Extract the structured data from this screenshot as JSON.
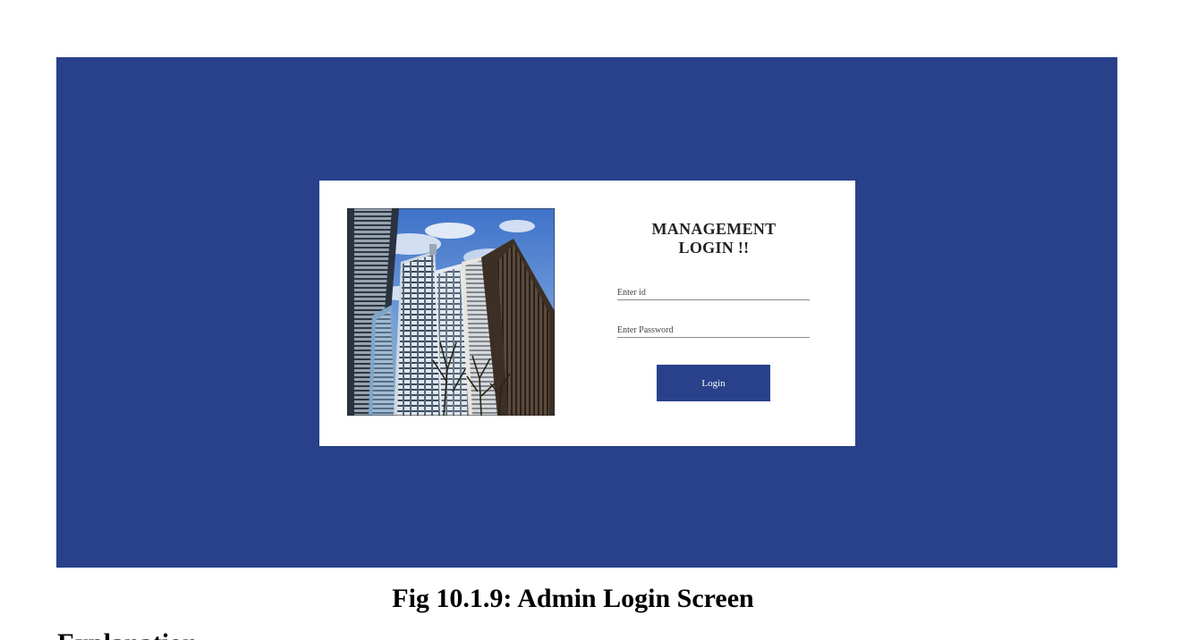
{
  "login": {
    "title": "MANAGEMENT LOGIN !!",
    "id_placeholder": "Enter id",
    "password_placeholder": "Enter Password",
    "button_label": "Login"
  },
  "caption": "Fig 10.1.9: Admin Login Screen",
  "next_heading_fragment": "Explanation",
  "colors": {
    "background": "#28418a",
    "card": "#ffffff",
    "button": "#28418a"
  },
  "icons": {
    "photo": "skyscrapers-photo"
  }
}
